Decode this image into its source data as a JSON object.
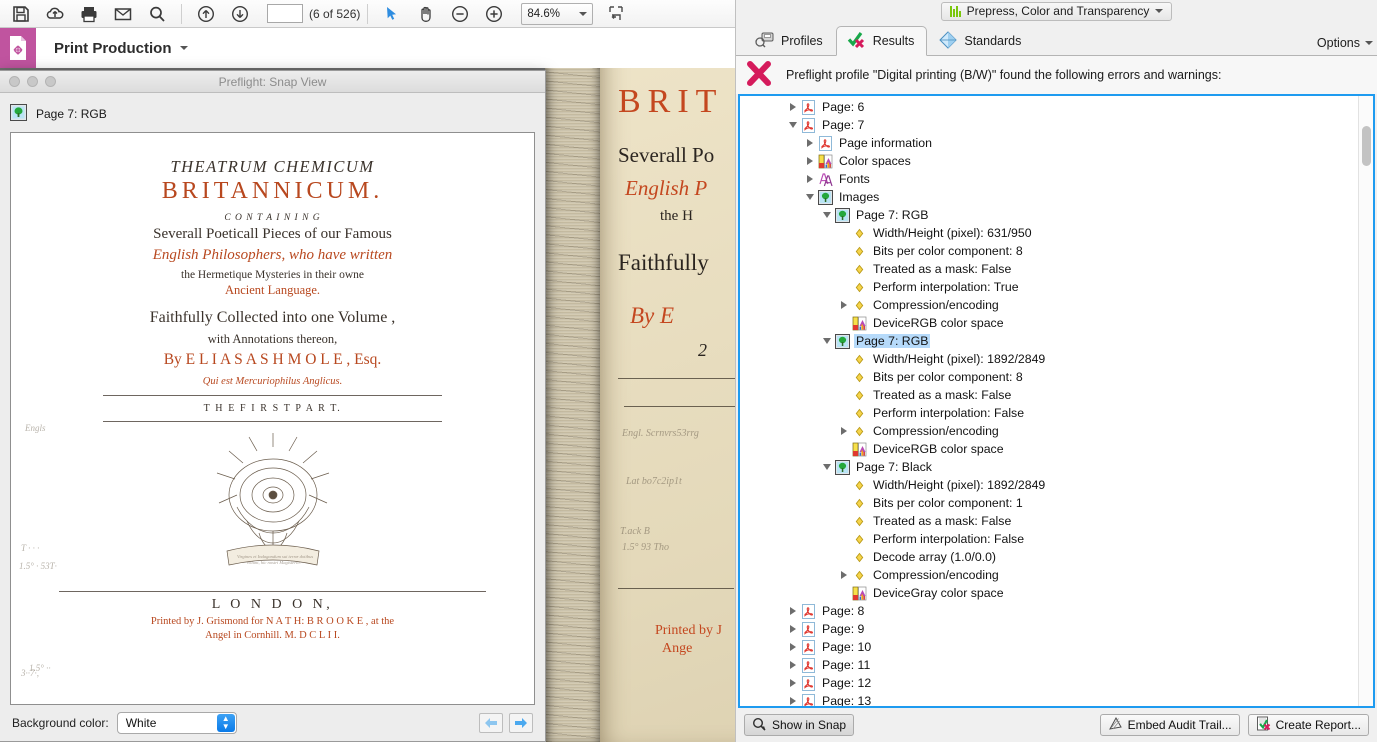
{
  "toolbar": {
    "icons": [
      "save-icon",
      "upload-cloud-icon",
      "print-icon",
      "email-icon",
      "search-icon",
      "previous-page-icon",
      "next-page-icon"
    ],
    "page_field_value": "",
    "page_counter": "(6 of 526)",
    "tools": [
      "select-tool",
      "hand-tool",
      "zoom-out-icon",
      "zoom-in-icon"
    ],
    "zoom_level": "84.6%",
    "fit_icon": "fit-page-icon"
  },
  "print_production": {
    "title": "Print Production",
    "panel_icon": "print-production-icon"
  },
  "snap_view": {
    "window_title": "Preflight: Snap View",
    "object_label": "Page 7: RGB",
    "object_icon": "image-object-icon",
    "background_color_label": "Background color:",
    "background_color_value": "White",
    "prev_label": "◀",
    "next_label": "▶",
    "page_facsimile": {
      "line1": "THEATRUM CHEMICUM",
      "line2": "BRITANNICUM.",
      "line3": "C O N T A I N I N G",
      "line4": "Severall Poeticall Pieces  of our Famous",
      "line5": "English Philosophers, who have written",
      "line6": "the Hermetique Mysteries in their owne",
      "line7": "Ancient Language.",
      "line8": "Faithfully Collected into one  Volume ,",
      "line9": "with Annotations thereon,",
      "line10": "By  E L I A S  A S H M O L E , Esq.",
      "line11": "Qui est Mercuriophilus Anglicus.",
      "line12": "T H E   F I R S T   P A R T.",
      "line13": "L O N D O N,",
      "line14": "Printed by J. Grismond for N A T H: B R O O K E , at the",
      "line15": "Angel in Cornhill.   M. D C L I I.",
      "scroll_motto": "Virgines et Indagandum sui terræ dotibus volunt, hic nostri Magisterio."
    }
  },
  "preflight": {
    "workspace_selector": {
      "label": "Prepress, Color and Transparency",
      "icon": "color-bars-icon"
    },
    "tabs": [
      {
        "label": "Profiles",
        "icon": "profiles-icon",
        "active": false
      },
      {
        "label": "Results",
        "icon": "results-check-x-icon",
        "active": true
      },
      {
        "label": "Standards",
        "icon": "standards-diamond-icon",
        "active": false
      }
    ],
    "options_label": "Options",
    "options_icon": "chevron-down-icon",
    "message": "Preflight profile \"Digital printing (B/W)\" found the following errors and warnings:",
    "message_icon": "error-x-icon",
    "buttons": {
      "show_in_snap": "Show in Snap",
      "show_in_snap_icon": "magnifier-icon",
      "embed_audit_trail": "Embed Audit Trail...",
      "embed_audit_trail_icon": "audit-trail-icon",
      "create_report": "Create Report...",
      "create_report_icon": "create-report-icon"
    },
    "tree": [
      {
        "indent": 1,
        "twisty": "closed",
        "icon": "pdf-page-icon",
        "label": "Page: 6",
        "selected": false
      },
      {
        "indent": 1,
        "twisty": "open",
        "icon": "pdf-page-icon",
        "label": "Page: 7",
        "selected": false
      },
      {
        "indent": 2,
        "twisty": "closed",
        "icon": "pdf-page-icon",
        "label": "Page information",
        "selected": false
      },
      {
        "indent": 2,
        "twisty": "closed",
        "icon": "colorspace-icon",
        "label": "Color spaces",
        "selected": false
      },
      {
        "indent": 2,
        "twisty": "closed",
        "icon": "fonts-icon",
        "label": "Fonts",
        "selected": false
      },
      {
        "indent": 2,
        "twisty": "open",
        "icon": "image-object-icon",
        "label": "Images",
        "selected": false
      },
      {
        "indent": 3,
        "twisty": "open",
        "icon": "image-object-icon",
        "label": "Page 7: RGB",
        "selected": false
      },
      {
        "indent": 4,
        "twisty": "none",
        "icon": "diamond-bullet-icon",
        "label": "Width/Height (pixel): 631/950",
        "selected": false
      },
      {
        "indent": 4,
        "twisty": "none",
        "icon": "diamond-bullet-icon",
        "label": "Bits per color component: 8",
        "selected": false
      },
      {
        "indent": 4,
        "twisty": "none",
        "icon": "diamond-bullet-icon",
        "label": "Treated as a mask: False",
        "selected": false
      },
      {
        "indent": 4,
        "twisty": "none",
        "icon": "diamond-bullet-icon",
        "label": "Perform interpolation: True",
        "selected": false
      },
      {
        "indent": 4,
        "twisty": "closed",
        "icon": "diamond-bullet-icon",
        "label": "Compression/encoding",
        "selected": false
      },
      {
        "indent": 4,
        "twisty": "none",
        "icon": "colorspace-icon",
        "label": "DeviceRGB color space",
        "selected": false
      },
      {
        "indent": 3,
        "twisty": "open",
        "icon": "image-object-icon",
        "label": "Page 7: RGB",
        "selected": true
      },
      {
        "indent": 4,
        "twisty": "none",
        "icon": "diamond-bullet-icon",
        "label": "Width/Height (pixel): 1892/2849",
        "selected": false
      },
      {
        "indent": 4,
        "twisty": "none",
        "icon": "diamond-bullet-icon",
        "label": "Bits per color component: 8",
        "selected": false
      },
      {
        "indent": 4,
        "twisty": "none",
        "icon": "diamond-bullet-icon",
        "label": "Treated as a mask: False",
        "selected": false
      },
      {
        "indent": 4,
        "twisty": "none",
        "icon": "diamond-bullet-icon",
        "label": "Perform interpolation: False",
        "selected": false
      },
      {
        "indent": 4,
        "twisty": "closed",
        "icon": "diamond-bullet-icon",
        "label": "Compression/encoding",
        "selected": false
      },
      {
        "indent": 4,
        "twisty": "none",
        "icon": "colorspace-icon",
        "label": "DeviceRGB color space",
        "selected": false
      },
      {
        "indent": 3,
        "twisty": "open",
        "icon": "image-object-icon",
        "label": "Page 7: Black",
        "selected": false
      },
      {
        "indent": 4,
        "twisty": "none",
        "icon": "diamond-bullet-icon",
        "label": "Width/Height (pixel): 1892/2849",
        "selected": false
      },
      {
        "indent": 4,
        "twisty": "none",
        "icon": "diamond-bullet-icon",
        "label": "Bits per color component: 1",
        "selected": false
      },
      {
        "indent": 4,
        "twisty": "none",
        "icon": "diamond-bullet-icon",
        "label": "Treated as a mask: False",
        "selected": false
      },
      {
        "indent": 4,
        "twisty": "none",
        "icon": "diamond-bullet-icon",
        "label": "Perform interpolation: False",
        "selected": false
      },
      {
        "indent": 4,
        "twisty": "none",
        "icon": "diamond-bullet-icon",
        "label": "Decode array (1.0/0.0)",
        "selected": false
      },
      {
        "indent": 4,
        "twisty": "closed",
        "icon": "diamond-bullet-icon",
        "label": "Compression/encoding",
        "selected": false
      },
      {
        "indent": 4,
        "twisty": "none",
        "icon": "colorspace-icon",
        "label": "DeviceGray color space",
        "selected": false
      },
      {
        "indent": 1,
        "twisty": "closed",
        "icon": "pdf-page-icon",
        "label": "Page: 8",
        "selected": false
      },
      {
        "indent": 1,
        "twisty": "closed",
        "icon": "pdf-page-icon",
        "label": "Page: 9",
        "selected": false
      },
      {
        "indent": 1,
        "twisty": "closed",
        "icon": "pdf-page-icon",
        "label": "Page: 10",
        "selected": false
      },
      {
        "indent": 1,
        "twisty": "closed",
        "icon": "pdf-page-icon",
        "label": "Page: 11",
        "selected": false
      },
      {
        "indent": 1,
        "twisty": "closed",
        "icon": "pdf-page-icon",
        "label": "Page: 12",
        "selected": false
      },
      {
        "indent": 1,
        "twisty": "closed",
        "icon": "pdf-page-icon",
        "label": "Page: 13",
        "selected": false
      }
    ]
  },
  "colors": {
    "accent_blue": "#1e9bf0",
    "selection_blue": "#b6dafa",
    "error_crimson": "#d51b5c",
    "magenta_swatch": "#c0549f",
    "green_bars": "#7ac70c"
  }
}
